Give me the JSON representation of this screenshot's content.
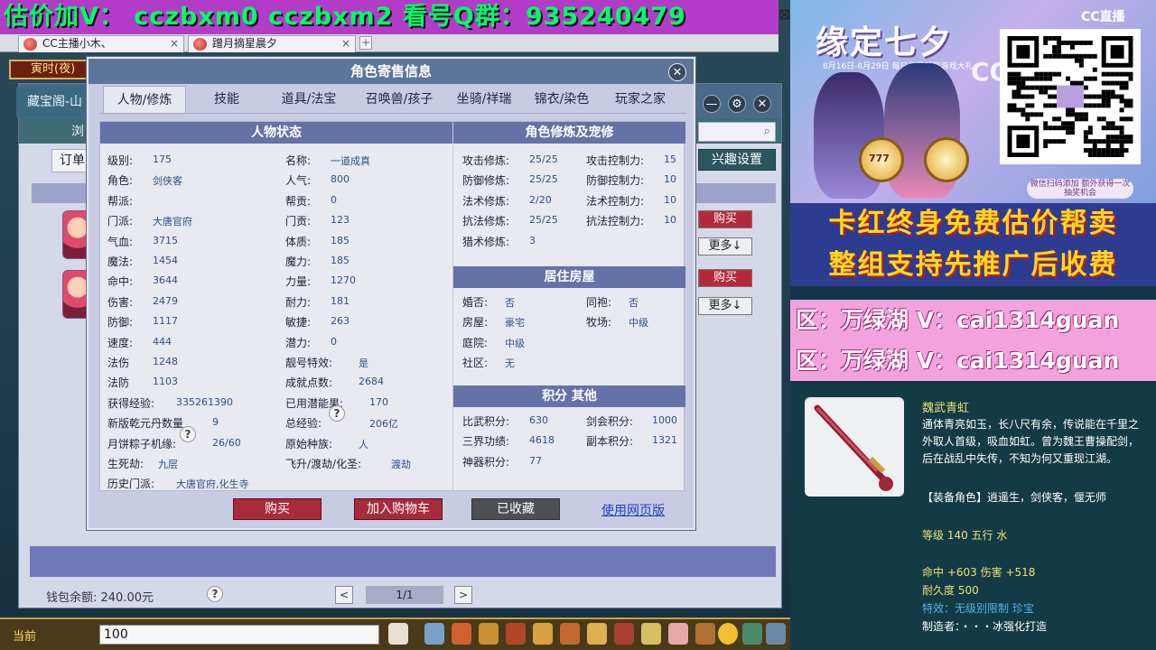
{
  "banner": {
    "text": "估价加V：  cczbxm0   cczbxm2   看号Q群：935240479",
    "close": "⊠"
  },
  "browser": {
    "tabs": [
      {
        "label": "CC主播小木、",
        "close": "×"
      },
      {
        "label": "蹭月摘星晨夕",
        "close": "×"
      }
    ],
    "add": "+"
  },
  "hud": {
    "time": "寅时(夜)",
    "cbg": "藏宝阁-山"
  },
  "backwin": {
    "nav_label": "浏",
    "order_label": "订单",
    "interest_label": "兴趣设置",
    "search_icon": "⌕",
    "buy_label": "购买",
    "more_label": "更多↓",
    "wallet_label": "钱包余额: 240.00元",
    "help": "?",
    "page": "1/1",
    "prev": "<",
    "next": ">",
    "ctrl": [
      "—",
      "⚙",
      "✕"
    ]
  },
  "hotbar": {
    "now": "当前",
    "input_value": "100"
  },
  "modal": {
    "title": "角色寄售信息",
    "close": "✕",
    "tabs": [
      "人物/修炼",
      "技能",
      "道具/法宝",
      "召唤兽/孩子",
      "坐骑/祥瑞",
      "锦衣/染色",
      "玩家之家"
    ],
    "status_title": "人物状态",
    "cultivation_title": "角色修炼及宠修",
    "house_title": "居住房屋",
    "score_title": "积分 其他",
    "left_col": [
      {
        "label": "级别:",
        "value": "175"
      },
      {
        "label": "角色:",
        "value": "剑侠客"
      },
      {
        "label": "帮派:",
        "value": ""
      },
      {
        "label": "门派:",
        "value": "大唐官府"
      },
      {
        "label": "气血:",
        "value": "3715"
      },
      {
        "label": "魔法:",
        "value": "1454"
      },
      {
        "label": "命中:",
        "value": "3644"
      },
      {
        "label": "伤害:",
        "value": "2479"
      },
      {
        "label": "防御:",
        "value": "1117"
      },
      {
        "label": "速度:",
        "value": "444"
      },
      {
        "label": "法伤",
        "value": "1248"
      },
      {
        "label": "法防",
        "value": "1103"
      },
      {
        "label": "获得经验:",
        "value": "335261390"
      },
      {
        "label": "新版乾元丹数量",
        "value": "9"
      },
      {
        "label": "月饼粽子机缘:",
        "value": "26/60"
      },
      {
        "label": "生死劫:",
        "value": "九层"
      },
      {
        "label": "历史门派:",
        "value": "大唐官府,化生寺"
      }
    ],
    "mid_col": [
      {
        "label": "名称:",
        "value": "一道成真"
      },
      {
        "label": "人气:",
        "value": "800"
      },
      {
        "label": "帮贡:",
        "value": "0"
      },
      {
        "label": "门贡:",
        "value": "123"
      },
      {
        "label": "体质:",
        "value": "185"
      },
      {
        "label": "魔力:",
        "value": "185"
      },
      {
        "label": "力量:",
        "value": "1270"
      },
      {
        "label": "耐力:",
        "value": "181"
      },
      {
        "label": "敏捷:",
        "value": "263"
      },
      {
        "label": "潜力:",
        "value": "0"
      },
      {
        "label": "靓号特效:",
        "value": "是"
      },
      {
        "label": "成就点数:",
        "value": "2684"
      },
      {
        "label": "已用潜能果:",
        "value": "170"
      },
      {
        "label": "总经验:",
        "value": "206亿"
      },
      {
        "label": "原始种族:",
        "value": "人"
      },
      {
        "label": "飞升/渡劫/化圣:",
        "value": "渡劫"
      }
    ],
    "cultivation": [
      {
        "label": "攻击修炼:",
        "value": "25/25",
        "label2": "攻击控制力:",
        "value2": "15"
      },
      {
        "label": "防御修炼:",
        "value": "25/25",
        "label2": "防御控制力:",
        "value2": "10"
      },
      {
        "label": "法术修炼:",
        "value": "2/20",
        "label2": "法术控制力:",
        "value2": "10"
      },
      {
        "label": "抗法修炼:",
        "value": "25/25",
        "label2": "抗法控制力:",
        "value2": "10"
      },
      {
        "label": "猎术修炼:",
        "value": "3",
        "label2": "",
        "value2": ""
      }
    ],
    "house": [
      {
        "label": "婚否:",
        "value": "否",
        "label2": "同袍:",
        "value2": "否"
      },
      {
        "label": "房屋:",
        "value": "豪宅",
        "label2": "牧场:",
        "value2": "中级"
      },
      {
        "label": "庭院:",
        "value": "中级",
        "label2": "",
        "value2": ""
      },
      {
        "label": "社区:",
        "value": "无",
        "label2": "",
        "value2": ""
      }
    ],
    "score": [
      {
        "label": "比武积分:",
        "value": "630",
        "label2": "剑会积分:",
        "value2": "1000"
      },
      {
        "label": "三界功绩:",
        "value": "4618",
        "label2": "副本积分:",
        "value2": "1321"
      },
      {
        "label": "神器积分:",
        "value": "77",
        "label2": "",
        "value2": ""
      }
    ],
    "help": "?",
    "buy": "购买",
    "add_cart": "加入购物车",
    "favorited": "已收藏",
    "web_link": "使用网页版"
  },
  "right": {
    "event_title": "缘定七夕",
    "event_sub": "8月16日-8月29日 每日登录领取游戏大礼",
    "event_btn": "微信扫码添加\n额外获得一次抽奖机会",
    "cc_logo": "CC直播",
    "coin_text": "777",
    "promo1": "卡红终身免费估价帮卖",
    "promo2": "整组支持先推广后收费",
    "region1": "区：万绿湖 V：cai1314guan",
    "region2": "区：万绿湖 V：cai1314guan",
    "item": {
      "name": "魏武青虹",
      "desc": "通体青亮如玉，长八尺有余，传说能在千里之外取人首级，吸血如虹。曾为魏王曹操配剑，后在战乱中失传，不知为何又重现江湖。",
      "equip": "【装备角色】逍遥生，剑侠客，偃无师",
      "level": "等级 140 五行 水",
      "stats": "命中 +603 伤害 +518",
      "durability": "耐久度 500",
      "effect": "特效：无级别限制 珍宝",
      "maker": "制造者：・・・冰强化打造"
    }
  },
  "colors": {
    "banner_bg": "#b23cc8",
    "banner_fg": "#00ff66",
    "modal_head": "#5d7598",
    "section_head": "#6572a8",
    "buy_red": "#a82b3c",
    "promo_fg": "#ffd820",
    "region_bg": "#f2a3dc"
  }
}
